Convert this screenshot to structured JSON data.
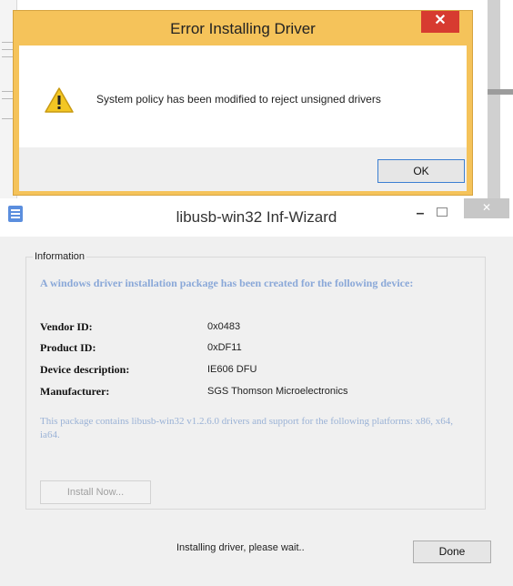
{
  "error_dialog": {
    "title": "Error Installing Driver",
    "close_glyph": "✕",
    "message": "System policy has been modified to reject unsigned drivers",
    "ok_label": "OK",
    "icon": "warning-icon"
  },
  "wizard": {
    "title": "libusb-win32 Inf-Wizard",
    "minimize_glyph": "–",
    "close_glyph": "✕",
    "group_label": "Information",
    "heading": "A windows driver installation package has been created for the following device:",
    "fields": [
      {
        "key": "Vendor ID:",
        "value": "0x0483"
      },
      {
        "key": "Product ID:",
        "value": "0xDF11"
      },
      {
        "key": "Device description:",
        "value": "IE606 DFU"
      },
      {
        "key": "Manufacturer:",
        "value": "SGS Thomson Microelectronics"
      }
    ],
    "package_note": "This package contains libusb-win32 v1.2.6.0 drivers and support for the following platforms: x86, x64, ia64.",
    "install_label": "Install Now...",
    "status": "Installing driver, please wait..",
    "done_label": "Done"
  },
  "colors": {
    "error_frame": "#f5c35a",
    "close_red": "#d73b30",
    "heading_blue": "#8aa8d8"
  }
}
